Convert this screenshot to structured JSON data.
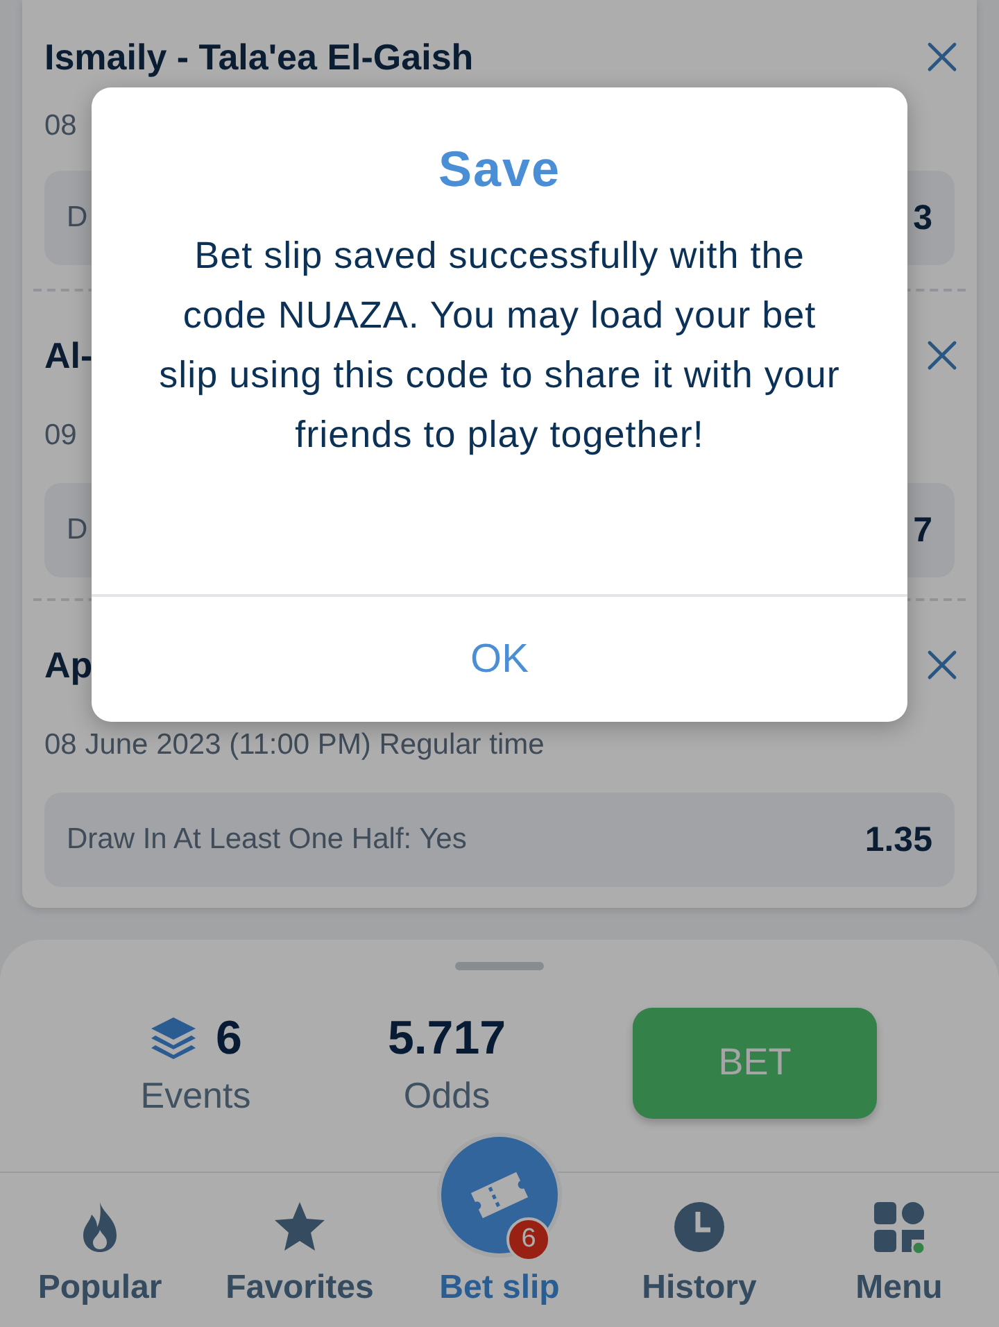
{
  "bets": [
    {
      "title": "Ismaily - Tala'ea El-Gaish",
      "date": "08",
      "market": "D",
      "odds": "3"
    },
    {
      "title": "Al-",
      "date": "09",
      "market": "D",
      "odds": "7"
    },
    {
      "title": "Ap",
      "date": "08 June 2023 (11:00 PM) Regular time",
      "market": "Draw In At Least One Half: Yes",
      "odds": "1.35"
    }
  ],
  "summary": {
    "events_count": "6",
    "events_label": "Events",
    "odds_value": "5.717",
    "odds_label": "Odds",
    "bet_button": "BET"
  },
  "nav": [
    {
      "label": "Popular",
      "kind": "flame",
      "selected": false
    },
    {
      "label": "Favorites",
      "kind": "star",
      "selected": false
    },
    {
      "label": "Bet slip",
      "kind": "ticket",
      "selected": true,
      "badge": "6"
    },
    {
      "label": "History",
      "kind": "clock",
      "selected": false
    },
    {
      "label": "Menu",
      "kind": "grid",
      "selected": false
    }
  ],
  "dialog": {
    "title": "Save",
    "message": "Bet slip saved successfully with the code NUAZA. You may load your bet slip using this code to share it with your friends to play together!",
    "button": "OK"
  }
}
